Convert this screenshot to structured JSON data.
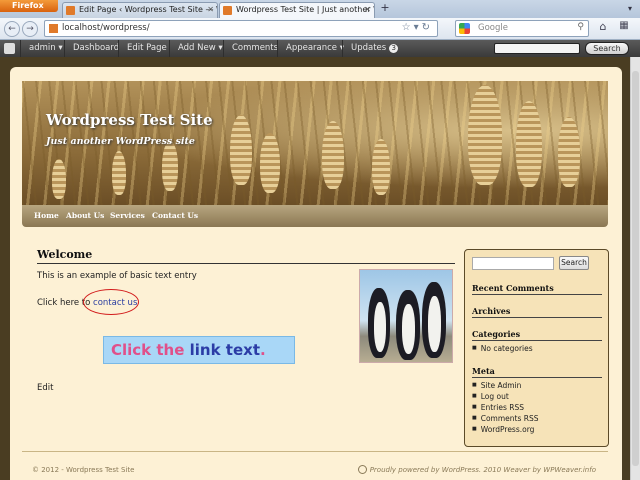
{
  "browser": {
    "menu_label": "Firefox",
    "tabs": [
      {
        "title": "Edit Page ‹ Wordpress Test Site — Wo..."
      },
      {
        "title": "Wordpress Test Site | Just another Wo..."
      }
    ],
    "url": "localhost/wordpress/",
    "search_placeholder": "Google"
  },
  "adminbar": {
    "items": [
      {
        "label": "admin ▾"
      },
      {
        "label": "Dashboard"
      },
      {
        "label": "Edit Page"
      },
      {
        "label": "Add New ▾"
      },
      {
        "label": "Comments"
      },
      {
        "label": "Appearance ▾"
      },
      {
        "label": "Updates"
      }
    ],
    "updates_count": "3",
    "search_button": "Search"
  },
  "site": {
    "title": "Wordpress Test Site",
    "description": "Just another WordPress site",
    "menu": [
      "Home",
      "About Us",
      "Services",
      "Contact Us"
    ]
  },
  "post": {
    "title": "Welcome",
    "text": "This is an example of basic text entry",
    "link_prefix": "Click here to ",
    "link_text": "contact us",
    "callout_part1": "Click the",
    "callout_part2": "link text",
    "callout_part3": ".",
    "edit": "Edit"
  },
  "sidebar": {
    "search_button": "Search",
    "recent_comments": "Recent Comments",
    "archives": "Archives",
    "categories": "Categories",
    "categories_items": [
      "No categories"
    ],
    "meta": "Meta",
    "meta_items": [
      "Site Admin",
      "Log out",
      "Entries RSS",
      "Comments RSS",
      "WordPress.org"
    ]
  },
  "footer": {
    "left": "© 2012 - Wordpress Test Site",
    "right": "Proudly powered by WordPress. 2010 Weaver by WPWeaver.info"
  }
}
